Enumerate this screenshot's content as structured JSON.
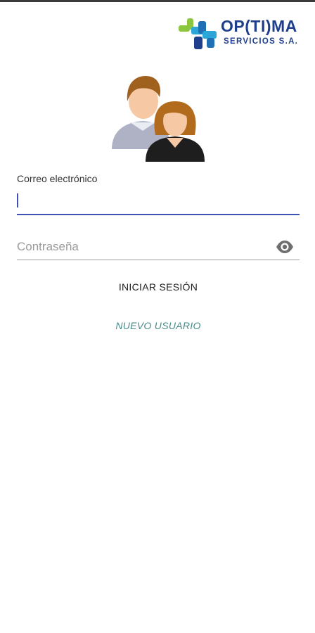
{
  "logo": {
    "title": "OP(TI)MA",
    "subtitle": "SERVICIOS S.A."
  },
  "form": {
    "email_label": "Correo electrónico",
    "email_value": "",
    "password_placeholder": "Contraseña",
    "login_button": "INICIAR SESIÓN",
    "new_user_button": "NUEVO USUARIO"
  },
  "colors": {
    "accent": "#3f51b5",
    "brand_blue": "#1f3f8c",
    "link_teal": "#4a8a8a"
  }
}
